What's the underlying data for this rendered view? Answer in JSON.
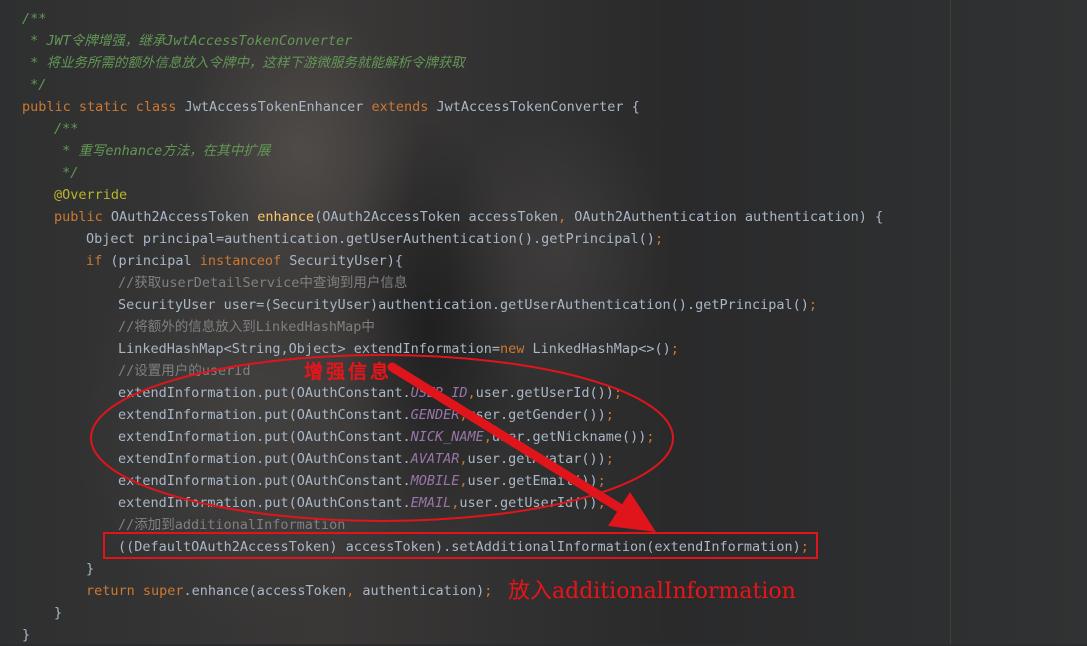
{
  "colors": {
    "background": "#2b2c2d",
    "comment": "#629755",
    "keyword": "#cc7832",
    "annotation": "#bbb529",
    "method": "#ffc66d",
    "static_field": "#9876aa",
    "line_comment": "#808080",
    "text": "#a9b7c6",
    "highlight_red": "#e8141a"
  },
  "code": {
    "l1": "/**",
    "l2": " * JWT令牌增强，继承JwtAccessTokenConverter",
    "l3": " * 将业务所需的额外信息放入令牌中，这样下游微服务就能解析令牌获取",
    "l4": " */",
    "l5": {
      "kw": "public static class ",
      "name": "JwtAccessTokenEnhancer ",
      "kw2": "extends ",
      "rest": "JwtAccessTokenConverter {"
    },
    "l6": "/**",
    "l7": " * 重写enhance方法，在其中扩展",
    "l8": " */",
    "l9": "@Override",
    "l10": {
      "kw": "public ",
      "type": "OAuth2AccessToken ",
      "method": "enhance",
      "p1": "(OAuth2AccessToken accessToken",
      "comma": ", ",
      "p2": "OAuth2Authentication authentication) {"
    },
    "l11": {
      "text": "Object principal=authentication.getUserAuthentication().getPrincipal()",
      "semi": ";"
    },
    "l12": {
      "kw": "if ",
      "p1": "(principal ",
      "kw2": "instanceof ",
      "p2": "SecurityUser){"
    },
    "l13": "//获取userDetailService中查询到用户信息",
    "l14": {
      "text": "SecurityUser user=(SecurityUser)authentication.getUserAuthentication().getPrincipal()",
      "semi": ";"
    },
    "l15": "//将额外的信息放入到LinkedHashMap中",
    "l16": {
      "text": "LinkedHashMap<String,Object> extendInformation=",
      "kw": "new ",
      "rest": "LinkedHashMap<>()",
      "semi": ";"
    },
    "l17": "//设置用户的userId",
    "l18": {
      "pre": "extendInformation.put(OAuthConstant.",
      "const": "USER_ID",
      "comma": ",",
      "post": "user.getUserId())",
      "semi": ";"
    },
    "l19": {
      "pre": "extendInformation.put(OAuthConstant.",
      "const": "GENDER",
      "comma": ",",
      "post": "user.getGender())",
      "semi": ";"
    },
    "l20": {
      "pre": "extendInformation.put(OAuthConstant.",
      "const": "NICK_NAME",
      "comma": ",",
      "post": "user.getNickname())",
      "semi": ";"
    },
    "l21": {
      "pre": "extendInformation.put(OAuthConstant.",
      "const": "AVATAR",
      "comma": ",",
      "post": "user.getAvatar())",
      "semi": ";"
    },
    "l22": {
      "pre": "extendInformation.put(OAuthConstant.",
      "const": "MOBILE",
      "comma": ",",
      "post": "user.getEmail())",
      "semi": ";"
    },
    "l23": {
      "pre": "extendInformation.put(OAuthConstant.",
      "const": "EMAIL",
      "comma": ",",
      "post": "user.getUserId())",
      "semi": ";"
    },
    "l24": "//添加到additionalInformation",
    "l25": {
      "text": "((DefaultOAuth2AccessToken) accessToken).setAdditionalInformation(extendInformation)",
      "semi": ";"
    },
    "l26": "}",
    "l27": {
      "kw": "return super",
      "rest": ".enhance(accessToken",
      "comma": ", ",
      "rest2": "authentication)",
      "semi": ";"
    },
    "l28": "}",
    "l29": "}"
  },
  "annotations": {
    "enhance_info": "增强信息",
    "put_additional": "放入additionalInformation"
  }
}
